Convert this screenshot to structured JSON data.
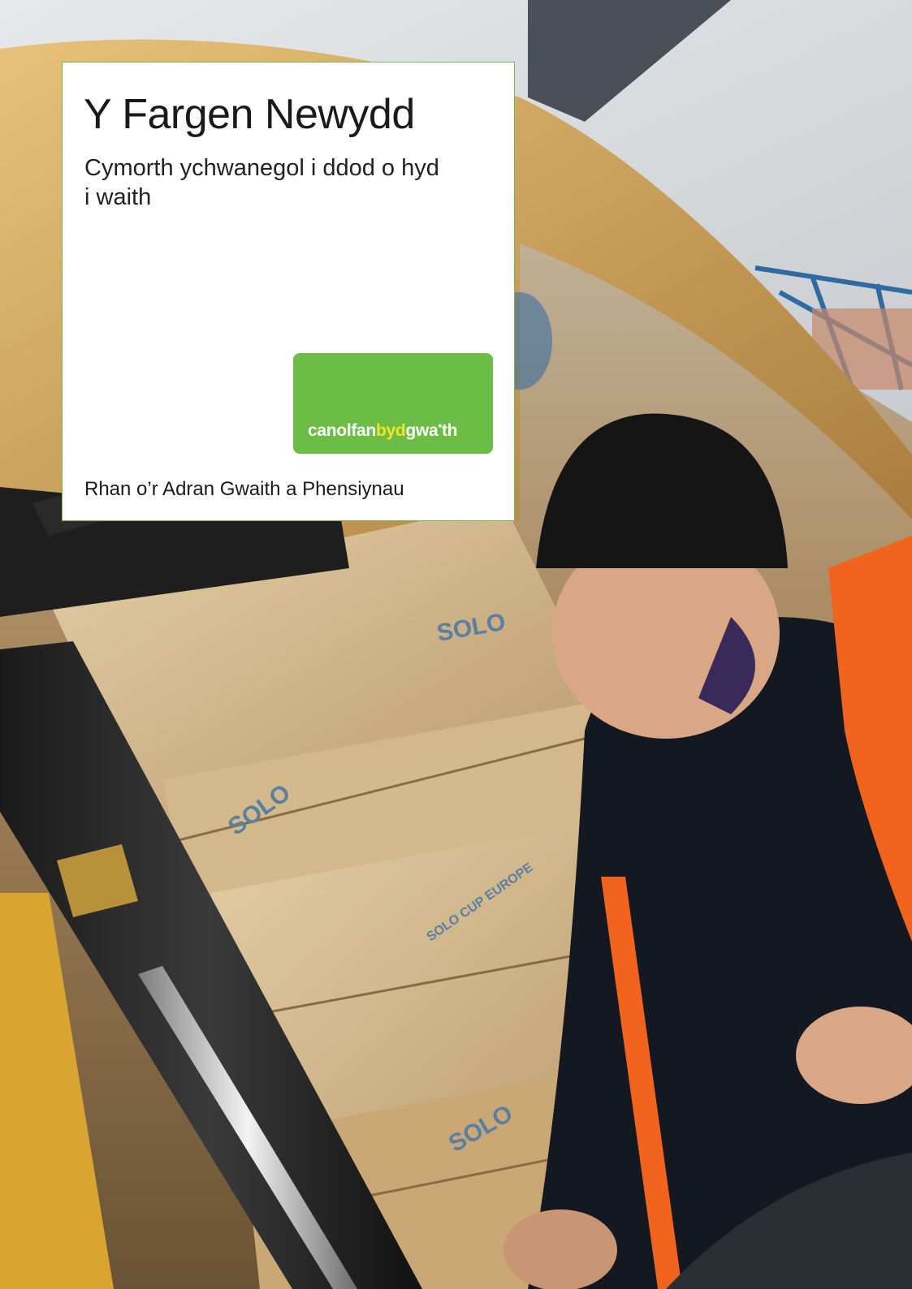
{
  "cover": {
    "title": "Y Fargen Newydd",
    "subtitle": "Cymorth ychwanegol i ddod o hyd i waith",
    "footer": "Rhan o’r Adran Gwaith a Phensiynau"
  },
  "logo": {
    "part1": "canolfan",
    "part2": "byd",
    "part3": "gwa",
    "part4": "th",
    "background_color": "#6cbd45",
    "accent_color": "#f2e32a"
  },
  "photo": {
    "box_print_1": "SOLO",
    "box_print_2": "SOLO CUP EUROPE"
  },
  "colors": {
    "brand_green": "#6cbd45",
    "vest_orange": "#f0641e"
  }
}
